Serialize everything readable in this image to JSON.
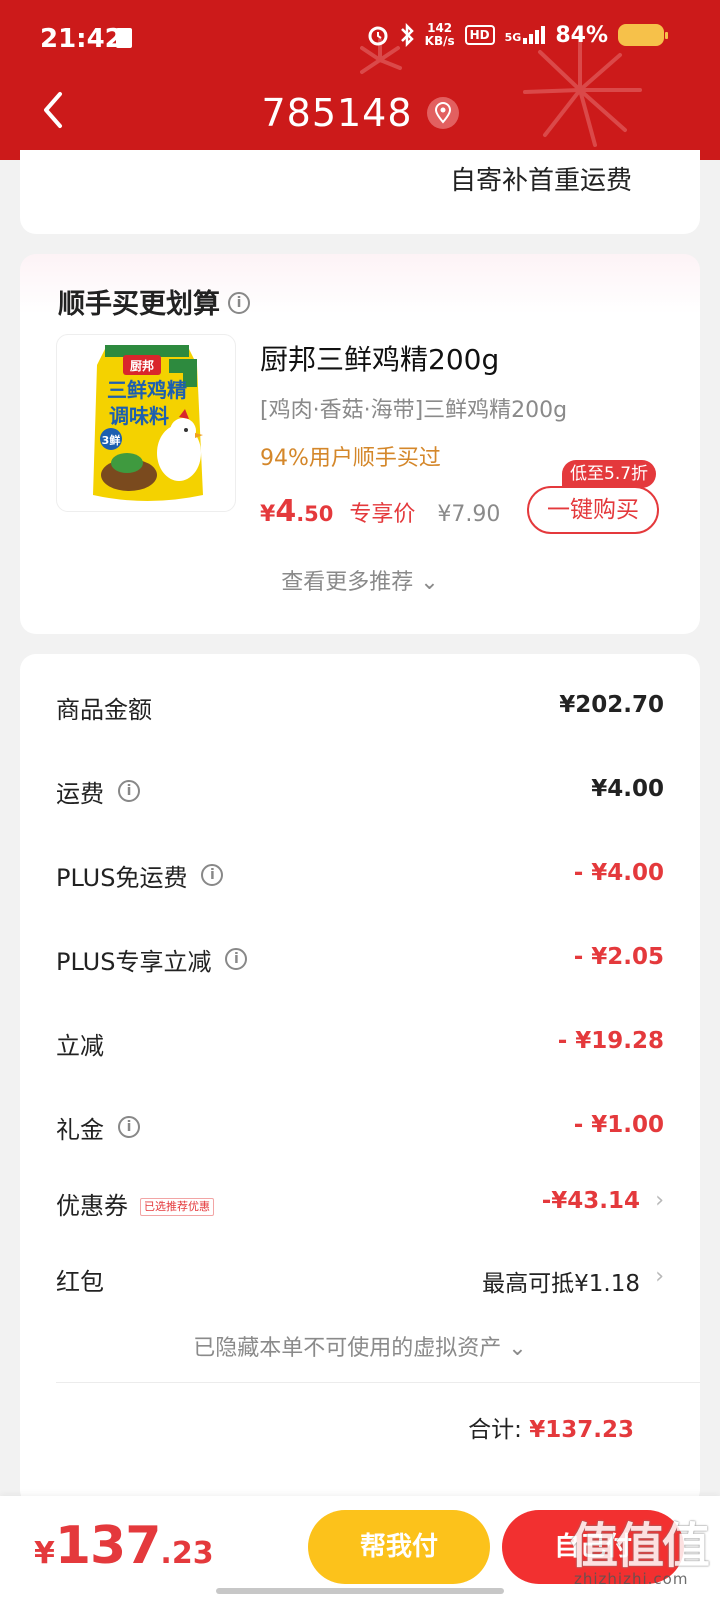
{
  "status_bar": {
    "time": "21:42",
    "net_speed_value": "142",
    "net_speed_unit": "KB/s",
    "hd_label": "HD",
    "network_label": "5G",
    "battery": "84%"
  },
  "header": {
    "title": "785148",
    "bg_color": "#cc1a1a"
  },
  "shipping": {
    "note": "自寄补首重运费"
  },
  "recommend": {
    "title": "顺手买更划算",
    "product": {
      "name": "厨邦三鲜鸡精200g",
      "spec": "[鸡肉·香菇·海带]三鲜鸡精200g",
      "bought_pct": "94%用户顺手买过",
      "price_yen": "¥",
      "price_int": "4",
      "price_dec": ".50",
      "price_tag": "专享价",
      "original_price": "¥7.90",
      "discount_badge": "低至5.7折",
      "buy_button": "一键购买",
      "image": {
        "brand": "厨邦",
        "line1": "三鲜鸡精",
        "line2": "调味料",
        "badge": "3鲜"
      }
    },
    "more_label": "查看更多推荐"
  },
  "summary": {
    "rows": [
      {
        "label": "商品金额",
        "value": "¥202.70"
      },
      {
        "label": "运费",
        "value": "¥4.00"
      },
      {
        "label": "PLUS免运费",
        "value": "- ¥4.00"
      },
      {
        "label": "PLUS专享立减",
        "value": "- ¥2.05"
      },
      {
        "label": "立减",
        "value": "- ¥19.28"
      },
      {
        "label": "礼金",
        "value": "- ¥1.00"
      },
      {
        "label": "优惠券",
        "tag": "已选推荐优惠",
        "value": "-¥43.14"
      },
      {
        "label": "红包",
        "value": "最高可抵¥1.18"
      }
    ],
    "hidden_assets": "已隐藏本单不可使用的虚拟资产",
    "total_label": "合计:",
    "total_value": "¥137.23"
  },
  "bottom_bar": {
    "total_yen": "¥",
    "total_int": "137",
    "total_dec": ".23",
    "help_pay": "帮我付",
    "pay": "自己付"
  },
  "watermark": {
    "logo": "值值值",
    "url": "zhizhizhi.com"
  },
  "colors": {
    "accent_red": "#e4393c",
    "help_yellow": "#fcc21b",
    "pct_orange": "#d4872a"
  }
}
